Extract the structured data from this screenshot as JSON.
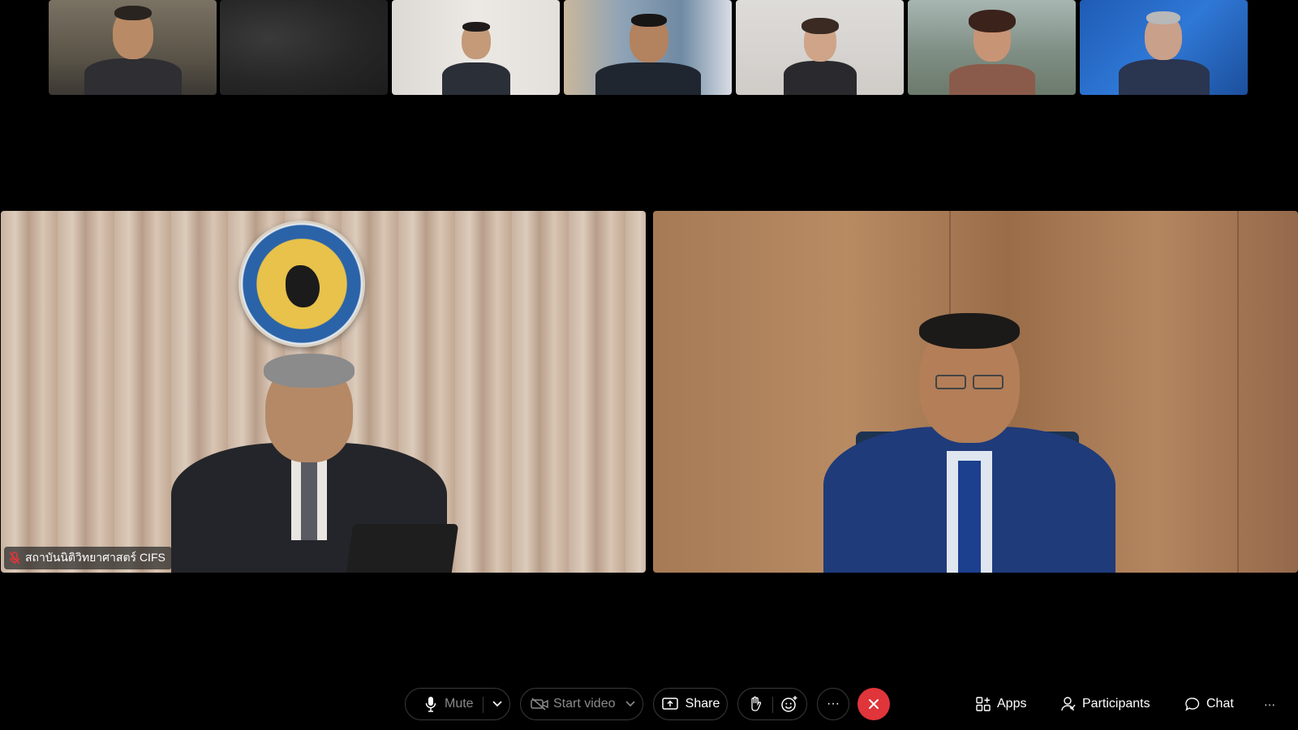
{
  "participants": {
    "thumbnails": [
      {
        "bg": "#6c6558",
        "suit": "#2e2e33",
        "skin": "#b98a66",
        "hair": "#2a2420"
      },
      {
        "bg": "#2a2a2a",
        "suit": "",
        "skin": "",
        "hair": ""
      },
      {
        "bg": "#e6e3df",
        "suit": "#2b2f38",
        "skin": "#c49a79",
        "hair": "#1e1b1a"
      },
      {
        "bg": "#7f8f9e",
        "suit": "#1f2630",
        "skin": "#b3825f",
        "hair": "#181515"
      },
      {
        "bg": "#d8d6d3",
        "suit": "#2a2a2e",
        "skin": "#cfa489",
        "hair": "#3a2a22"
      },
      {
        "bg": "#8e9a92",
        "suit": "#8a5b4a",
        "skin": "#c89476",
        "hair": "#3b221a"
      },
      {
        "bg": "#2a6bc4",
        "suit": "#2a3550",
        "skin": "#c9a08a",
        "hair": "#b8b8b8"
      }
    ],
    "main_left": {
      "name": "สถาบันนิติวิทยาศาสตร์ CIFS",
      "mic_state": "muted-mic-icon"
    },
    "main_right": {
      "name": ""
    }
  },
  "toolbar": {
    "mute_label": "Mute",
    "start_video_label": "Start video",
    "share_label": "Share",
    "more_label": "···",
    "apps_label": "Apps",
    "participants_label": "Participants",
    "chat_label": "Chat",
    "overflow_label": "···",
    "end_color": "#e0353b"
  }
}
